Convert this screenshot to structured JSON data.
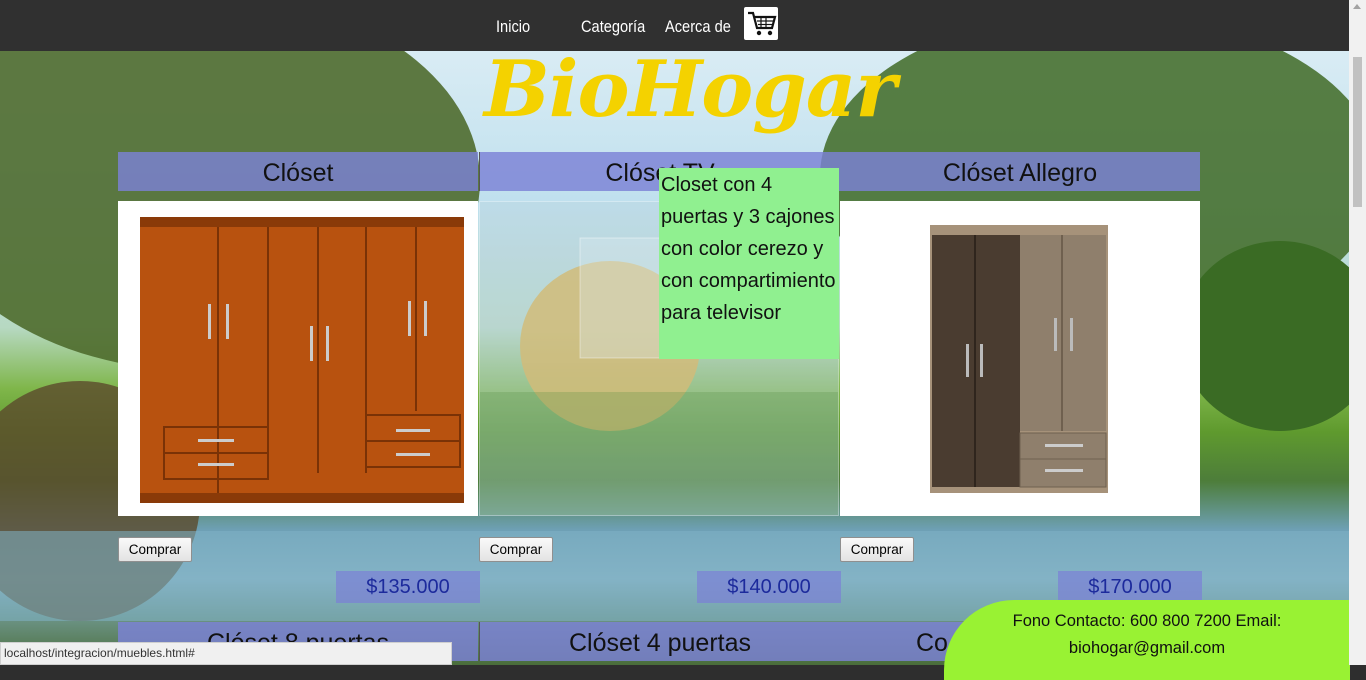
{
  "nav": {
    "items": [
      "Inicio",
      "Categoría",
      "Acerca de"
    ],
    "cart_icon": "shopping-cart-icon"
  },
  "brand": {
    "title": "BioHogar"
  },
  "products_row1": [
    {
      "name": "Clóset",
      "price": "$135.000",
      "button": "Comprar"
    },
    {
      "name": "Clóset TV",
      "price": "$140.000",
      "button": "Comprar"
    },
    {
      "name": "Clóset Allegro",
      "price": "$170.000",
      "button": "Comprar"
    }
  ],
  "products_row2": [
    "Clóset 8 puertas",
    "Clóset 4 puertas",
    "Co"
  ],
  "tooltip": {
    "text": "Closet con 4 puertas y 3 cajones con color cerezo y con compartimiento para televisor"
  },
  "contact": {
    "line1": "Fono Contacto: 600 800 7200 Email:",
    "line2": "biohogar@gmail.com"
  },
  "status": {
    "url": "localhost/integracion/muebles.html#"
  },
  "colors": {
    "accent_brand": "#f4d200",
    "title_band": "#7b81d6",
    "contact_bg": "#99f233",
    "tooltip_bg": "#90f090"
  }
}
